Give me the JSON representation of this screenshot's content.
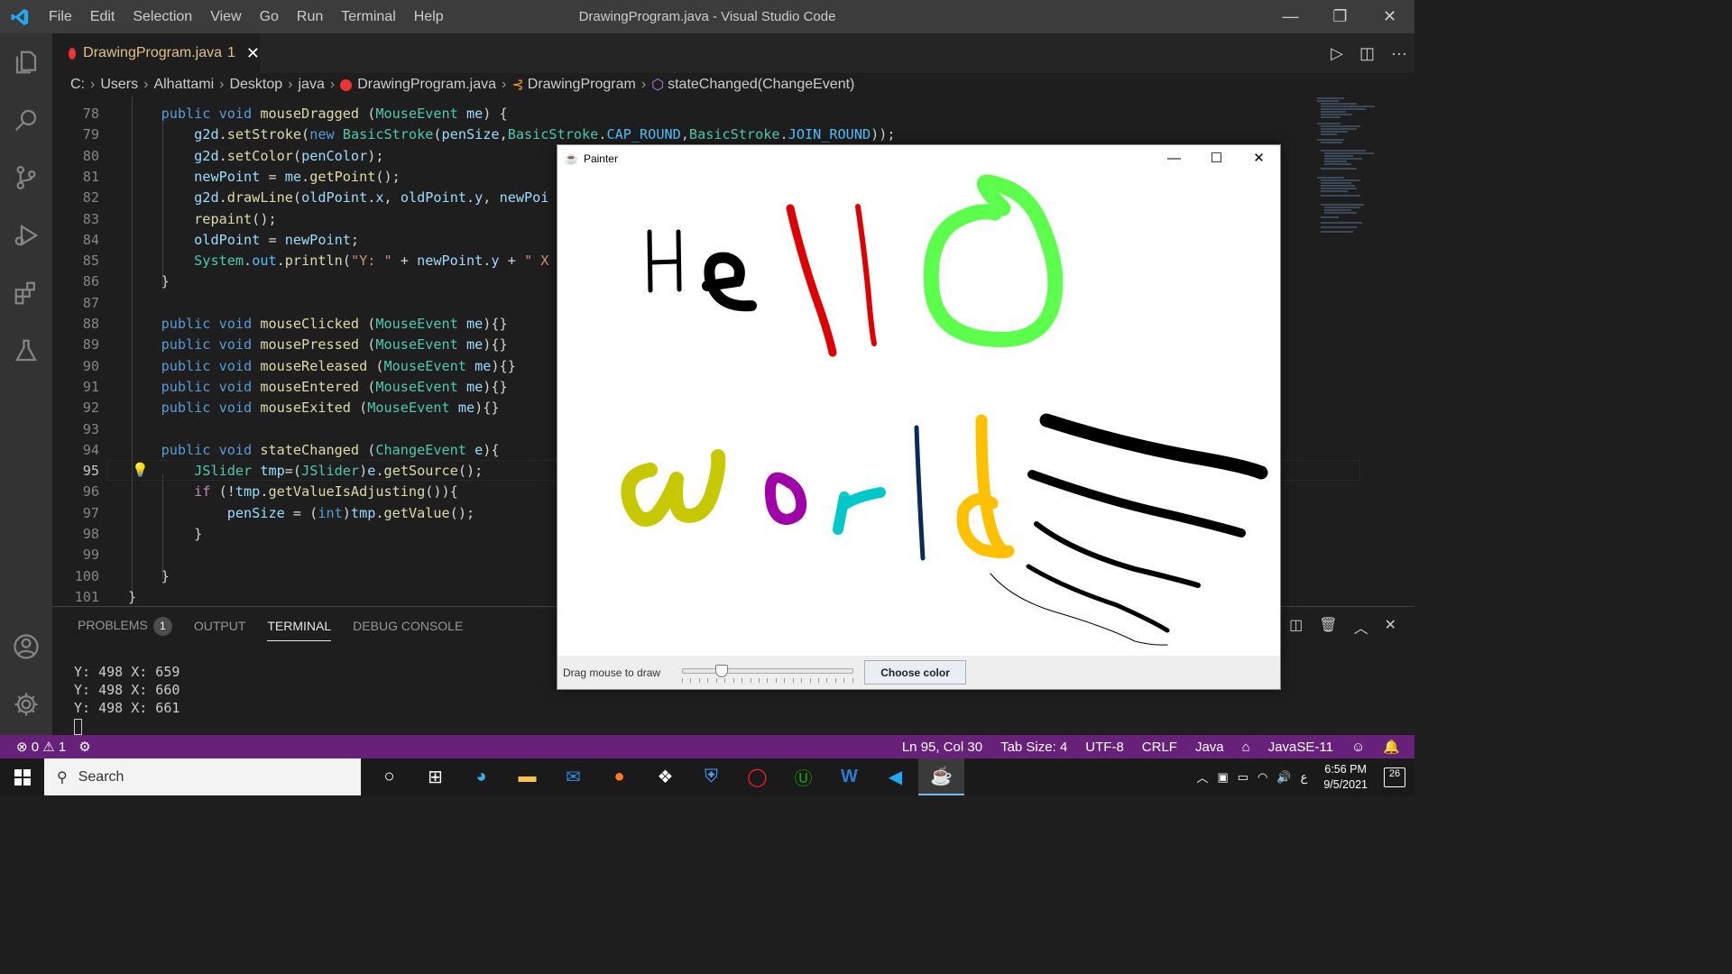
{
  "window": {
    "title": "DrawingProgram.java - Visual Studio Code",
    "menu": [
      "File",
      "Edit",
      "Selection",
      "View",
      "Go",
      "Run",
      "Terminal",
      "Help"
    ],
    "controls": [
      "—",
      "❐",
      "✕"
    ]
  },
  "tab": {
    "label": "DrawingProgram.java",
    "problems": "1"
  },
  "breadcrumb": [
    "C:",
    "Users",
    "Alhattami",
    "Desktop",
    "java",
    "DrawingProgram.java",
    "DrawingProgram",
    "stateChanged(ChangeEvent)"
  ],
  "editor": {
    "lines": [
      {
        "n": "78",
        "html": "    <span class='k'>public</span> <span class='k'>void</span> <span class='f'>mouseDragged</span> (<span class='t'>MouseEvent</span> <span class='v'>me</span>) {"
      },
      {
        "n": "79",
        "html": "        <span class='v'>g2d</span>.<span class='f'>setStroke</span>(<span class='k'>new</span> <span class='t'>BasicStroke</span>(<span class='v'>penSize</span>,<span class='t'>BasicStroke</span>.<span class='c'>CAP_ROUND</span>,<span class='t'>BasicStroke</span>.<span class='c'>JOIN_ROUND</span>));"
      },
      {
        "n": "80",
        "html": "        <span class='v'>g2d</span>.<span class='f'>setColor</span>(<span class='v'>penColor</span>);"
      },
      {
        "n": "81",
        "html": "        <span class='v'>newPoint</span> = <span class='v'>me</span>.<span class='f'>getPoint</span>();"
      },
      {
        "n": "82",
        "html": "        <span class='v'>g2d</span>.<span class='f'>drawLine</span>(<span class='v'>oldPoint</span>.<span class='v'>x</span>, <span class='v'>oldPoint</span>.<span class='v'>y</span>, <span class='v'>newPoi</span>"
      },
      {
        "n": "83",
        "html": "        <span class='f'>repaint</span>();"
      },
      {
        "n": "84",
        "html": "        <span class='v'>oldPoint</span> = <span class='v'>newPoint</span>;"
      },
      {
        "n": "85",
        "html": "        <span class='t'>System</span>.<span class='c'>out</span>.<span class='f'>println</span>(<span class='s'>\"Y: \"</span> + <span class='v'>newPoint</span>.<span class='v'>y</span> + <span class='s'>\" X</span>"
      },
      {
        "n": "86",
        "html": "    }"
      },
      {
        "n": "87",
        "html": ""
      },
      {
        "n": "88",
        "html": "    <span class='k'>public</span> <span class='k'>void</span> <span class='f'>mouseClicked</span> (<span class='t'>MouseEvent</span> <span class='v'>me</span>){}"
      },
      {
        "n": "89",
        "html": "    <span class='k'>public</span> <span class='k'>void</span> <span class='f'>mousePressed</span> (<span class='t'>MouseEvent</span> <span class='v'>me</span>){}"
      },
      {
        "n": "90",
        "html": "    <span class='k'>public</span> <span class='k'>void</span> <span class='f'>mouseReleased</span> (<span class='t'>MouseEvent</span> <span class='v'>me</span>){}"
      },
      {
        "n": "91",
        "html": "    <span class='k'>public</span> <span class='k'>void</span> <span class='f'>mouseEntered</span> (<span class='t'>MouseEvent</span> <span class='v'>me</span>){}"
      },
      {
        "n": "92",
        "html": "    <span class='k'>public</span> <span class='k'>void</span> <span class='f'>mouseExited</span> (<span class='t'>MouseEvent</span> <span class='v'>me</span>){}"
      },
      {
        "n": "93",
        "html": ""
      },
      {
        "n": "94",
        "html": "    <span class='k'>public</span> <span class='k'>void</span> <span class='f'>stateChanged</span> (<span class='t'>ChangeEvent</span> <span class='v'>e</span>){"
      },
      {
        "n": "95",
        "html": "        <span class='t'>JSlider</span> <span class='v'>tmp</span>=(<span class='t'>JSlider</span>)<span class='v'>e</span>.<span class='f'>getSource</span>();"
      },
      {
        "n": "96",
        "html": "        <span class='kc'>if</span> (!<span class='v'>tmp</span>.<span class='f'>getValueIsAdjusting</span>()){"
      },
      {
        "n": "97",
        "html": "            <span class='v'>penSize</span> = (<span class='k'>int</span>)<span class='v'>tmp</span>.<span class='f'>getValue</span>();"
      },
      {
        "n": "98",
        "html": "        }"
      },
      {
        "n": "99",
        "html": ""
      },
      {
        "n": "100",
        "html": "    }"
      },
      {
        "n": "101",
        "html": "}"
      }
    ],
    "current_line": "95"
  },
  "panel": {
    "tabs": [
      "PROBLEMS",
      "OUTPUT",
      "TERMINAL",
      "DEBUG CONSOLE"
    ],
    "active_tab": "TERMINAL",
    "problems_count": "1",
    "terminal_lines": [
      "Y: 498 X: 659",
      "Y: 498 X: 660",
      "Y: 498 X: 661"
    ]
  },
  "status": {
    "errors": "0",
    "warnings": "1",
    "position": "Ln 95, Col 30",
    "tab_size": "Tab Size: 4",
    "encoding": "UTF-8",
    "eol": "CRLF",
    "language": "Java",
    "runtime": "JavaSE-11"
  },
  "taskbar": {
    "search_placeholder": "Search",
    "time": "6:56 PM",
    "date": "9/5/2021",
    "notifications": "26",
    "ime": "ع"
  },
  "painter": {
    "title": "Painter",
    "hint": "Drag mouse to draw",
    "button": "Choose color",
    "slider_fraction": 0.21,
    "colors": {
      "black": "#000000",
      "red": "#dd0000",
      "green": "#5dff4d",
      "olive": "#c8c800",
      "purple": "#a000a8",
      "cyan": "#00c8c8",
      "navy": "#0a2a5a",
      "orange": "#ffc000"
    }
  },
  "colors": {
    "accent": "#68217a",
    "activity": "#333333",
    "editor": "#1e1e1e"
  }
}
